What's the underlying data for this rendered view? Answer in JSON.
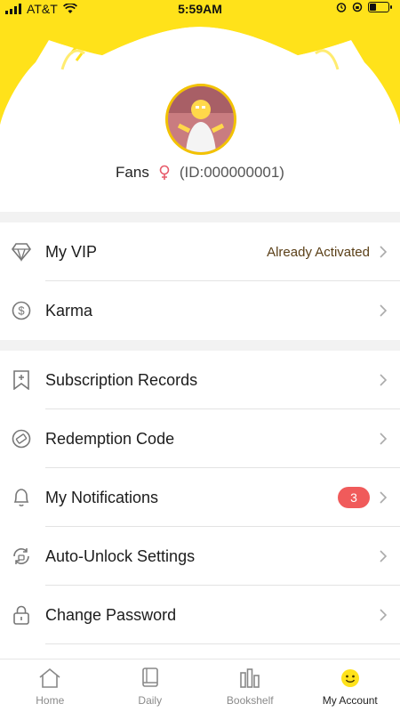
{
  "status_bar": {
    "carrier": "AT&T",
    "time": "5:59AM",
    "battery_level": 0.35
  },
  "profile": {
    "name": "Fans",
    "gender_icon": "female-icon",
    "id_text": "(ID:000000001)"
  },
  "colors": {
    "brand_yellow": "#FFE21A",
    "badge_red": "#F05B5B",
    "vip_value": "#5A3F17"
  },
  "menu_group_1": [
    {
      "icon": "diamond-icon",
      "label": "My VIP",
      "value": "Already Activated"
    },
    {
      "icon": "dollar-circle-icon",
      "label": "Karma",
      "value": ""
    }
  ],
  "menu_group_2": [
    {
      "icon": "bookmark-plus-icon",
      "label": "Subscription Records"
    },
    {
      "icon": "ticket-icon",
      "label": "Redemption Code"
    },
    {
      "icon": "bell-icon",
      "label": "My Notifications",
      "badge": "3"
    },
    {
      "icon": "refresh-lock-icon",
      "label": "Auto-Unlock Settings"
    },
    {
      "icon": "lock-icon",
      "label": "Change Password"
    }
  ],
  "tabs": [
    {
      "icon": "home-icon",
      "label": "Home",
      "active": false
    },
    {
      "icon": "daily-book-icon",
      "label": "Daily",
      "active": false
    },
    {
      "icon": "bookshelf-icon",
      "label": "Bookshelf",
      "active": false
    },
    {
      "icon": "smiley-icon",
      "label": "My Account",
      "active": true
    }
  ]
}
